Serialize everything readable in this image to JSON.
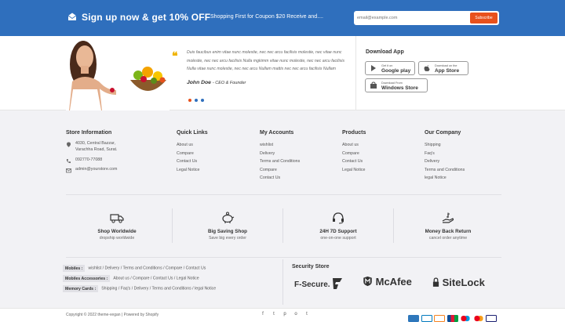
{
  "newsletter": {
    "title": "Sign up now & get 10% OFF",
    "message": "Shopping First for Coupon $20 Receive and....",
    "email_placeholder": "email@example.com",
    "subscribe_label": "Subscribe"
  },
  "testimonial": {
    "text": "Duis faucibus enim vitae nunc molestie, nec nec arcu facilisis molestie, nec vitae nunc molestie, nec nec arcu facilisis Nulla mgkimm vitae nunc molestie, nec nec arcu facilisis Nulla vitae nunc molestie, nec nec arcu Nullam mattis nec nec arcu facilisis Nullam",
    "author": "John Doe",
    "author_role": "- CEO & Founder"
  },
  "download": {
    "title": "Download App",
    "stores": [
      {
        "small": "Get it on",
        "big": "Google play"
      },
      {
        "small": "Download on the",
        "big": "App Store"
      },
      {
        "small": "Download From",
        "big": "Windows Store"
      }
    ]
  },
  "store_info": {
    "title": "Store Information",
    "address": [
      "4030, Central Bazzar,",
      "Varachha Road, Surat."
    ],
    "phone": "092770-77088",
    "email": "admin@yourstore.com"
  },
  "columns": [
    {
      "title": "Quick Links",
      "links": [
        "About us",
        "Compare",
        "Contact Us",
        "Legal Notice"
      ]
    },
    {
      "title": "My Accounts",
      "links": [
        "wishlist",
        "Delivery",
        "Terms and Conditions",
        "Compare",
        "Contact Us"
      ]
    },
    {
      "title": "Products",
      "links": [
        "About us",
        "Compare",
        "Contact Us",
        "Legal Notice"
      ]
    },
    {
      "title": "Our Company",
      "links": [
        "Shipping",
        "Faq's",
        "Delivery",
        "Terms and Conditions",
        "legal Notice"
      ]
    }
  ],
  "features": [
    {
      "title": "Shop Worldwide",
      "sub": "dropship worldwide",
      "icon": "truck-icon"
    },
    {
      "title": "Big Saving Shop",
      "sub": "Save big every order",
      "icon": "piggy-bank-icon"
    },
    {
      "title": "24H 7D Support",
      "sub": "one-on-one support",
      "icon": "headset-icon"
    },
    {
      "title": "Money Back Return",
      "sub": "cancel order anytime",
      "icon": "money-hand-icon"
    }
  ],
  "tags": [
    {
      "label": "Mobiles :",
      "text": "wishlist / Delivery / Terms and Conditions / Compare / Contact Us"
    },
    {
      "label": "Mobiles Accessories :",
      "text": "About us / Compare / Contact Us / Legal Notice"
    },
    {
      "label": "Memory Cards :",
      "text": "Shipping / Faq's / Delivery / Terms and Conditions / legal Notice"
    }
  ],
  "security": {
    "title": "Security Store",
    "brands": [
      "F-Secure.",
      "McAfee",
      "SiteLock"
    ]
  },
  "bottom": {
    "copyright": "Copyright © 2022 theme-vegan | Powered by Shopify",
    "social": [
      "f",
      "t",
      "p",
      "o",
      "t"
    ]
  },
  "colors": {
    "brand_blue": "#2f6fbd",
    "accent_orange": "#e8511c",
    "quote_yellow": "#f0b400"
  }
}
